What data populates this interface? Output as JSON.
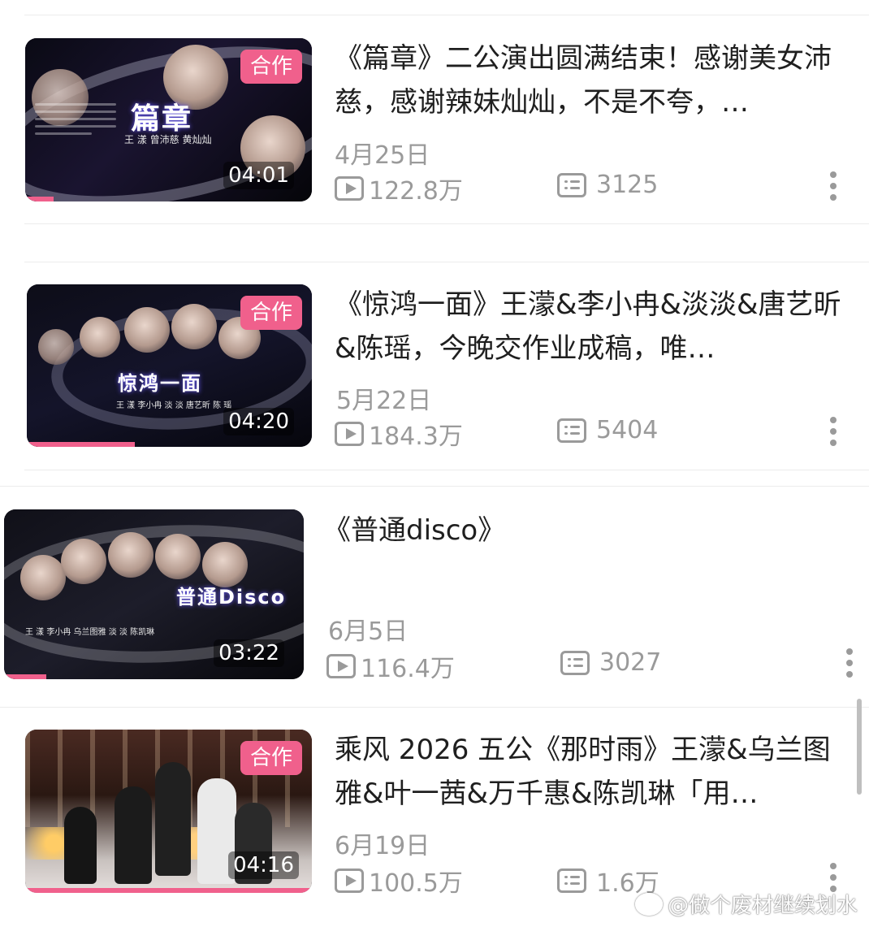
{
  "videos": [
    {
      "badge": "合作",
      "thumb_title": "篇章",
      "thumb_sub": "王 漾  曾沛慈  黄灿灿",
      "duration": "04:01",
      "progress": 0.1,
      "title": "《篇章》二公演出圆满结束！感谢美女沛慈，感谢辣妹灿灿，不是不夸，…",
      "date": "4月25日",
      "views": "122.8万",
      "comments": "3125"
    },
    {
      "badge": "合作",
      "thumb_title": "惊鸿一面",
      "thumb_sub": "王 漾  李小冉  淡 淡  唐艺昕  陈 瑶",
      "duration": "04:20",
      "progress": 0.38,
      "title": "《惊鸿一面》王濛&李小冉&淡淡&唐艺昕&陈瑶，今晚交作业成稿，唯…",
      "date": "5月22日",
      "views": "184.3万",
      "comments": "5404"
    },
    {
      "badge": "",
      "thumb_title": "普通Disco",
      "thumb_sub": "王 漾  李小冉  乌兰图雅  淡 淡  陈凯琳",
      "duration": "03:22",
      "progress": 0.14,
      "title": "《普通disco》",
      "date": "6月5日",
      "views": "116.4万",
      "comments": "3027"
    },
    {
      "badge": "合作",
      "thumb_title": "",
      "thumb_sub": "",
      "duration": "04:16",
      "progress": 1.0,
      "title": "乘风 2026 五公《那时雨》王濛&乌兰图雅&叶一茜&万千惠&陈凯琳「用…",
      "date": "6月19日",
      "views": "100.5万",
      "comments": "1.6万"
    }
  ],
  "watermark": "@做个废材继续划水",
  "colors": {
    "accent": "#f0608c",
    "meta": "#9a9a9a"
  },
  "icons": {
    "play": "play-count-icon",
    "danmu": "danmu-icon",
    "more": "more-vertical-icon"
  }
}
